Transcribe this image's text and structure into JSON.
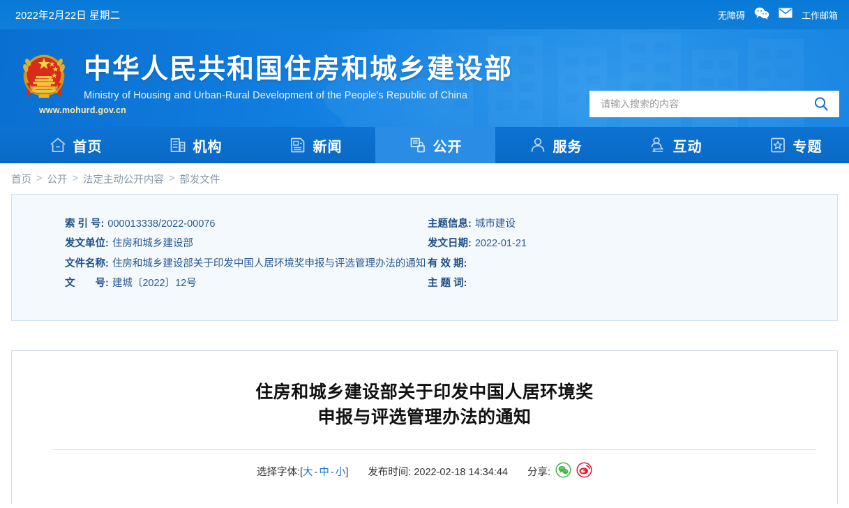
{
  "topbar": {
    "date": "2022年2月22日 星期二",
    "accessibility_label": "无障碍",
    "wechat_icon": "wechat-icon",
    "mail_icon": "envelope-icon",
    "mail_label": "工作邮箱"
  },
  "banner": {
    "emblem_icon": "national-emblem-icon",
    "title_cn": "中华人民共和国住房和城乡建设部",
    "title_en": "Ministry of Housing and Urban-Rural Development of the People's Republic of China",
    "site_url": "www.mohurd.gov.cn",
    "search": {
      "placeholder": "请输入搜索的内容",
      "value": "",
      "icon": "search-icon"
    }
  },
  "nav": {
    "items": [
      {
        "label": "首页",
        "icon": "home-icon",
        "active": false
      },
      {
        "label": "机构",
        "icon": "building-icon",
        "active": false
      },
      {
        "label": "新闻",
        "icon": "news-document-icon",
        "active": false
      },
      {
        "label": "公开",
        "icon": "open-info-icon",
        "active": true
      },
      {
        "label": "服务",
        "icon": "person-service-icon",
        "active": false
      },
      {
        "label": "互动",
        "icon": "interaction-icon",
        "active": false
      },
      {
        "label": "专题",
        "icon": "star-topic-icon",
        "active": false
      }
    ]
  },
  "breadcrumb": {
    "items": [
      "首页",
      "公开",
      "法定主动公开内容",
      "部发文件"
    ],
    "separator": ">"
  },
  "meta": {
    "left": [
      {
        "label": "索 引 号:",
        "value": "000013338/2022-00076"
      },
      {
        "label": "发文单位:",
        "value": "住房和城乡建设部"
      },
      {
        "label": "文件名称:",
        "value": "住房和城乡建设部关于印发中国人居环境奖申报与评选管理办法的通知"
      },
      {
        "label": "文　　号:",
        "value": "建城〔2022〕12号"
      }
    ],
    "right": [
      {
        "label": "主题信息:",
        "value": "城市建设"
      },
      {
        "label": "发文日期:",
        "value": "2022-01-21"
      },
      {
        "label": "有 效 期:",
        "value": ""
      },
      {
        "label": "主 题 词:",
        "value": ""
      }
    ]
  },
  "document": {
    "title_line1": "住房和城乡建设部关于印发中国人居环境奖",
    "title_line2": "申报与评选管理办法的通知",
    "toolbar": {
      "fontsize_label": "选择字体:",
      "bracket_open": "[",
      "bracket_close": "]",
      "size_large": "大",
      "size_medium": "中",
      "size_small": "小",
      "sep": "-",
      "publish_label": "发布时间:",
      "publish_time": "2022-02-18 14:34:44",
      "share_label": "分享:",
      "share_wechat_icon": "wechat-share-icon",
      "share_weibo_icon": "weibo-share-icon"
    }
  },
  "colors": {
    "brand_blue": "#0b7ad9",
    "nav_blue": "#0b6fcf",
    "nav_active_blue": "#2a8ce4",
    "link_blue": "#1a6fc4",
    "meta_card_bg": "#f4f9fe",
    "meta_border": "#cfe0f2",
    "wechat_green": "#44b549",
    "weibo_red": "#e6162d"
  }
}
